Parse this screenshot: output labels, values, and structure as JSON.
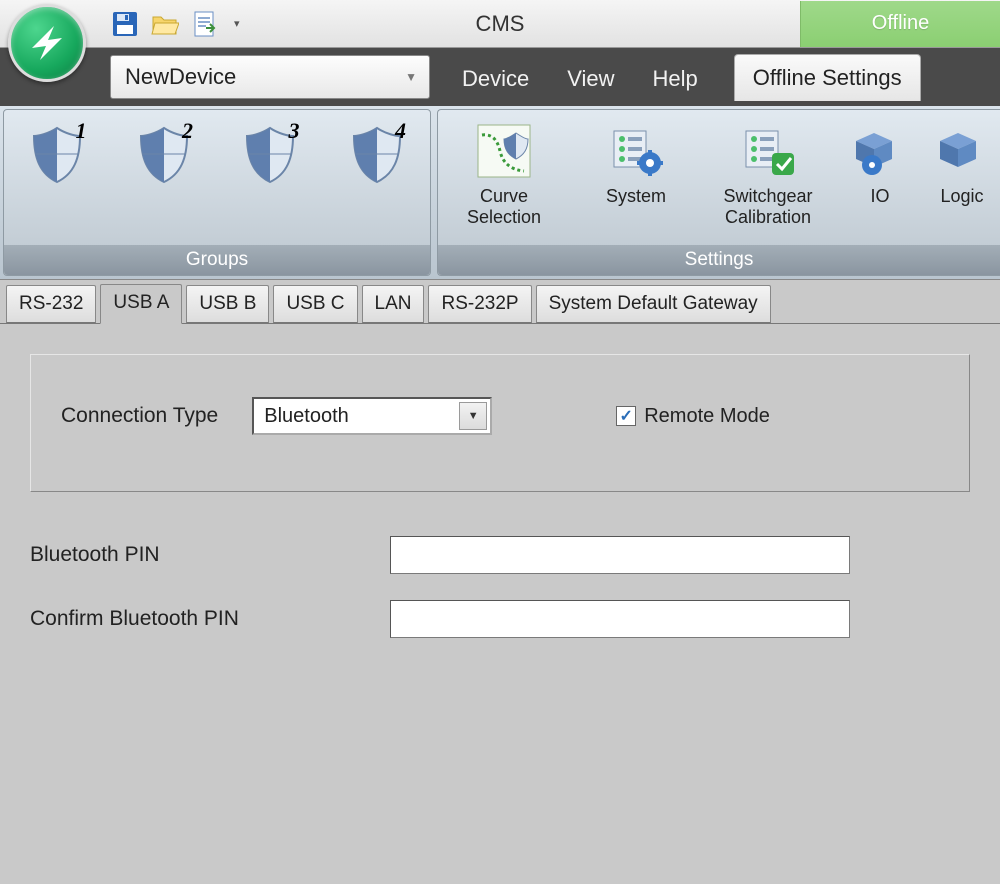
{
  "app_title": "CMS",
  "status": "Offline",
  "device_selector": {
    "value": "NewDevice"
  },
  "menu": {
    "items": [
      "Device",
      "View",
      "Help",
      "Offline Settings"
    ],
    "active_index": 3
  },
  "ribbon": {
    "groups_caption": "Groups",
    "settings_caption": "Settings",
    "shields": [
      "1",
      "2",
      "3",
      "4"
    ],
    "buttons": {
      "curve": "Curve Selection",
      "system": "System",
      "switchgear": "Switchgear Calibration",
      "io": "IO",
      "logic": "Logic"
    }
  },
  "subtabs": {
    "items": [
      "RS-232",
      "USB A",
      "USB B",
      "USB C",
      "LAN",
      "RS-232P",
      "System Default Gateway"
    ],
    "active_index": 1
  },
  "form": {
    "connection_type_label": "Connection Type",
    "connection_type_value": "Bluetooth",
    "remote_mode_label": "Remote Mode",
    "remote_mode_checked": true,
    "pin_label": "Bluetooth PIN",
    "confirm_pin_label": "Confirm Bluetooth PIN"
  }
}
